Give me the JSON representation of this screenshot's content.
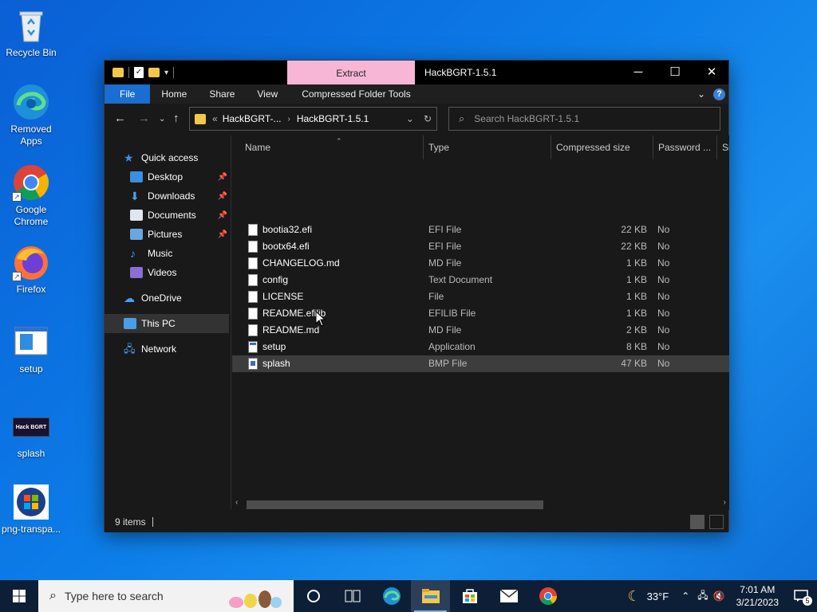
{
  "desktop": {
    "icons": [
      {
        "label": "Recycle Bin",
        "icon": "recycle-bin-icon"
      },
      {
        "label": "Removed\nApps",
        "icon": "edge-icon"
      },
      {
        "label": "Google\nChrome",
        "icon": "chrome-icon"
      },
      {
        "label": "Firefox",
        "icon": "firefox-icon"
      },
      {
        "label": "setup",
        "icon": "setup-icon"
      },
      {
        "label": "splash",
        "icon": "splash-image-icon",
        "image_text": "Hack BGRT"
      },
      {
        "label": "png-transpa...",
        "icon": "windows-logo-icon"
      }
    ]
  },
  "window": {
    "title": "HackBGRT-1.5.1",
    "context_tab": "Extract",
    "context_tab_color": "#f8b6d6",
    "controls": {
      "minimize": "─",
      "maximize": "☐",
      "close": "✕"
    },
    "ribbon_tabs": [
      "File",
      "Home",
      "Share",
      "View",
      "Compressed Folder Tools"
    ],
    "address": {
      "overflow": "«",
      "crumbs": [
        "HackBGRT-...",
        "HackBGRT-1.5.1"
      ]
    },
    "search_placeholder": "Search HackBGRT-1.5.1",
    "nav": {
      "items": [
        {
          "label": "Quick access",
          "icon": "star-icon",
          "pinned": false
        },
        {
          "label": "Desktop",
          "icon": "desktop-folder-icon",
          "pinned": true
        },
        {
          "label": "Downloads",
          "icon": "downloads-icon",
          "pinned": true
        },
        {
          "label": "Documents",
          "icon": "documents-icon",
          "pinned": true
        },
        {
          "label": "Pictures",
          "icon": "pictures-icon",
          "pinned": true
        },
        {
          "label": "Music",
          "icon": "music-icon",
          "pinned": false
        },
        {
          "label": "Videos",
          "icon": "videos-icon",
          "pinned": false
        },
        {
          "label": "OneDrive",
          "icon": "onedrive-icon",
          "pinned": false
        },
        {
          "label": "This PC",
          "icon": "this-pc-icon",
          "pinned": false
        },
        {
          "label": "Network",
          "icon": "network-icon",
          "pinned": false
        }
      ]
    },
    "columns": [
      "Name",
      "Type",
      "Compressed size",
      "Password ...",
      "Si"
    ],
    "files": [
      {
        "name": "bootia32.efi",
        "type": "EFI File",
        "size": "22 KB",
        "password": "No"
      },
      {
        "name": "bootx64.efi",
        "type": "EFI File",
        "size": "22 KB",
        "password": "No"
      },
      {
        "name": "CHANGELOG.md",
        "type": "MD File",
        "size": "1 KB",
        "password": "No"
      },
      {
        "name": "config",
        "type": "Text Document",
        "size": "1 KB",
        "password": "No"
      },
      {
        "name": "LICENSE",
        "type": "File",
        "size": "1 KB",
        "password": "No"
      },
      {
        "name": "README.efilib",
        "type": "EFILIB File",
        "size": "1 KB",
        "password": "No"
      },
      {
        "name": "README.md",
        "type": "MD File",
        "size": "2 KB",
        "password": "No"
      },
      {
        "name": "setup",
        "type": "Application",
        "size": "8 KB",
        "password": "No"
      },
      {
        "name": "splash",
        "type": "BMP File",
        "size": "47 KB",
        "password": "No"
      }
    ],
    "selected_file": "splash",
    "status": "9 items"
  },
  "taskbar": {
    "search_placeholder": "Type here to search",
    "weather": "33°F",
    "time": "7:01 AM",
    "date": "3/21/2023",
    "notification_count": "5"
  }
}
